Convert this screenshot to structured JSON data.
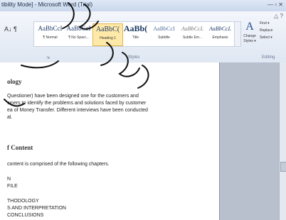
{
  "window": {
    "title": "tibility Mode] - Microsoft Word (Trial)",
    "controls": "— ▫ ✕"
  },
  "ribbon": {
    "help_label": "△ ?",
    "para_icons": "A↓ ¶",
    "styles": [
      {
        "sample": "AaBbCcI",
        "name": "¶ Normal"
      },
      {
        "sample": "AaBbCcI",
        "name": "¶ No Spaci..."
      },
      {
        "sample": "AaBbC(",
        "name": "Heading 1"
      },
      {
        "sample": "AaBb(",
        "name": "Title"
      },
      {
        "sample": "AaBbCcI",
        "name": "Subtitle"
      },
      {
        "sample": "AaBbCcL",
        "name": "Subtle Em..."
      },
      {
        "sample": "AaBbCcL",
        "name": "Emphasis"
      }
    ],
    "change_styles": {
      "icon": "A",
      "label1": "Change",
      "label2": "Styles ▾"
    },
    "editing": {
      "find": "Find ▾",
      "replace": "Replace",
      "select": "Select ▾"
    },
    "groups": {
      "styles": "Styles",
      "editing": "Editing",
      "paragraph_marker": "⇲"
    }
  },
  "document": {
    "heading1": "ology",
    "para1": [
      "Questioner) have been designed one for the customers and",
      "wners to identify the problems and solutions faced by customer",
      "ea of Money Transfer. Different interviews have been conducted",
      "al."
    ],
    "heading2": "f Content",
    "para2": "content is comprised of the following chapters.",
    "list": [
      "N",
      "FILE",
      "THODOLOGY",
      "S AND INTERPRETATION",
      "CONCLUSIONS"
    ]
  }
}
